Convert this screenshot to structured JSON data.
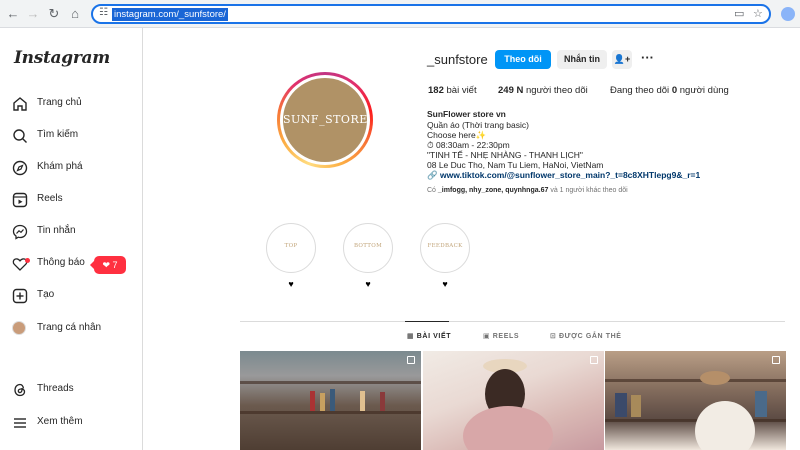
{
  "browser": {
    "url": "instagram.com/_sunfstore/"
  },
  "sidebar": {
    "logo": "Instagram",
    "items": [
      {
        "label": "Trang chủ",
        "icon": "home-icon"
      },
      {
        "label": "Tìm kiếm",
        "icon": "search-icon"
      },
      {
        "label": "Khám phá",
        "icon": "compass-icon"
      },
      {
        "label": "Reels",
        "icon": "reels-icon"
      },
      {
        "label": "Tin nhắn",
        "icon": "messenger-icon"
      },
      {
        "label": "Thông báo",
        "icon": "heart-icon"
      },
      {
        "label": "Tạo",
        "icon": "plus-square-icon"
      },
      {
        "label": "Trang cá nhân",
        "icon": "avatar"
      },
      {
        "label": "Threads",
        "icon": "threads-icon"
      },
      {
        "label": "Xem thêm",
        "icon": "menu-icon"
      }
    ],
    "notification_count": "7"
  },
  "profile": {
    "username": "_sunfstore",
    "avatar_text": "SUNF_STORE",
    "follow_label": "Theo dõi",
    "message_label": "Nhắn tin",
    "stats": {
      "posts_count": "182",
      "posts_label": "bài viết",
      "followers_count": "249 N",
      "followers_label": "người theo dõi",
      "following_prefix": "Đang theo dõi",
      "following_count": "0",
      "following_label": "người dùng"
    },
    "bio": {
      "name": "SunFlower store vn",
      "line1": "Quần áo (Thời trang basic)",
      "line2": "Choose here✨",
      "line3": "⏱ 08:30am - 22:30pm",
      "line4": "\"TINH TẾ - NHẸ NHÀNG - THANH LỊCH\"",
      "line5": "08 Le Duc Tho, Nam Tu Liem, HaNoi, VietNam",
      "link": "www.tiktok.com/@sunflower_store_main?_t=8c8XHTlepg9&_r=1"
    },
    "followed_by": {
      "prefix": "Có",
      "names": "_imfogg, nhy_zone, quynhnga.67",
      "suffix": "và 1 người khác theo dõi"
    }
  },
  "highlights": [
    {
      "label": "TOP"
    },
    {
      "label": "BOTTOM"
    },
    {
      "label": "FEEDBACK"
    }
  ],
  "tabs": [
    {
      "label": "BÀI VIẾT",
      "active": true
    },
    {
      "label": "REELS",
      "active": false
    },
    {
      "label": "ĐƯỢC GẮN THẺ",
      "active": false
    }
  ],
  "colors": {
    "accent": "#0095f6",
    "notification": "#ff3040",
    "avatar_bg": "#b09266"
  }
}
